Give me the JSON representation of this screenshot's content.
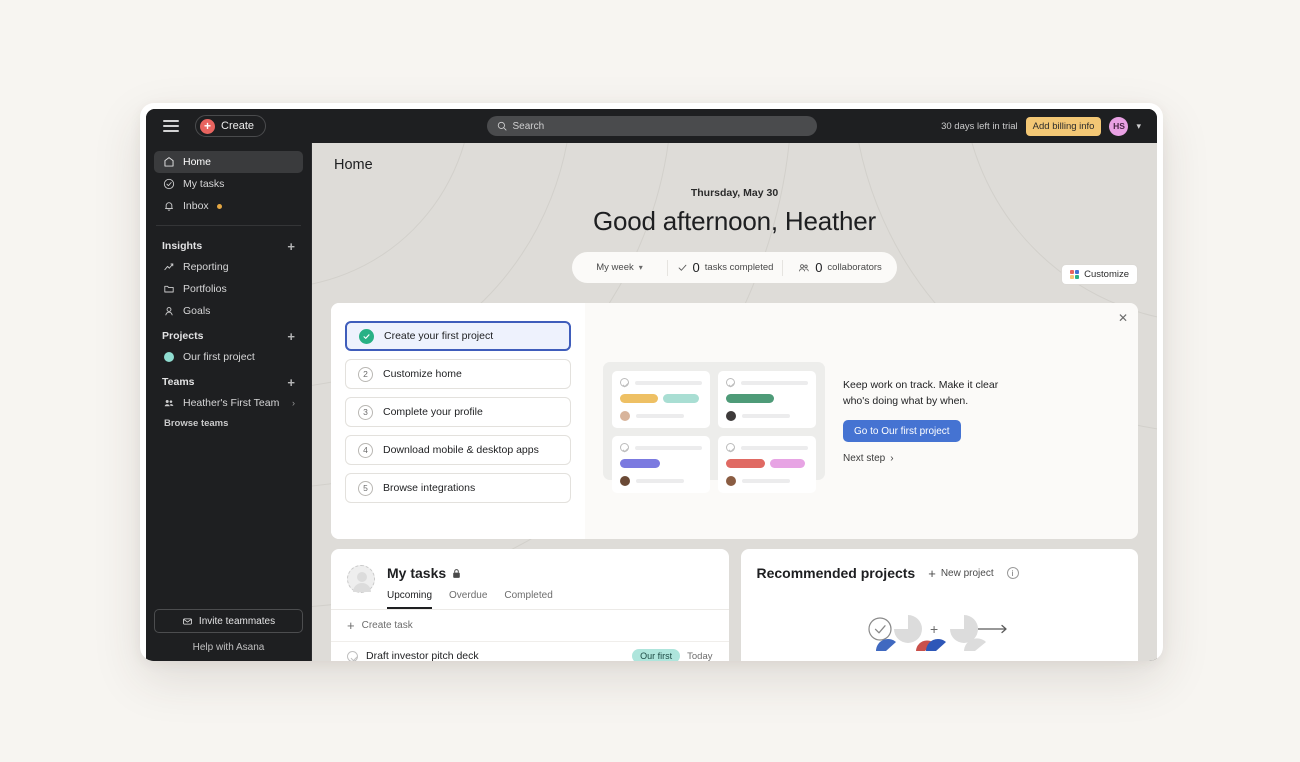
{
  "topbar": {
    "menu_icon": "hamburger-icon",
    "create_label": "Create",
    "search_placeholder": "Search",
    "trial_text": "30 days left in trial",
    "billing_label": "Add billing info",
    "avatar_initials": "HS"
  },
  "sidebar": {
    "primary": [
      {
        "label": "Home",
        "icon": "home-icon",
        "active": true
      },
      {
        "label": "My tasks",
        "icon": "check-circle-icon",
        "active": false
      },
      {
        "label": "Inbox",
        "icon": "bell-icon",
        "active": false,
        "badge": true
      }
    ],
    "insights": {
      "title": "Insights",
      "items": [
        {
          "label": "Reporting",
          "icon": "chart-line-icon"
        },
        {
          "label": "Portfolios",
          "icon": "folder-icon"
        },
        {
          "label": "Goals",
          "icon": "goal-icon"
        }
      ]
    },
    "projects": {
      "title": "Projects",
      "items": [
        {
          "label": "Our first project",
          "color": "#8fdcd0"
        }
      ]
    },
    "teams": {
      "title": "Teams",
      "items": [
        {
          "label": "Heather's First Team",
          "icon": "people-icon"
        }
      ],
      "browse_label": "Browse teams"
    },
    "invite_label": "Invite teammates",
    "help_label": "Help with Asana"
  },
  "main": {
    "page_title": "Home",
    "date": "Thursday, May 30",
    "greeting": "Good afternoon, Heather",
    "stats": {
      "range_label": "My week",
      "tasks_value": "0",
      "tasks_label": "tasks completed",
      "collaborators_value": "0",
      "collaborators_label": "collaborators"
    },
    "customize_label": "Customize"
  },
  "onboarding": {
    "steps": [
      {
        "num": "1",
        "label": "Create your first project",
        "done": true
      },
      {
        "num": "2",
        "label": "Customize home",
        "done": false
      },
      {
        "num": "3",
        "label": "Complete your profile",
        "done": false
      },
      {
        "num": "4",
        "label": "Download mobile & desktop apps",
        "done": false
      },
      {
        "num": "5",
        "label": "Browse integrations",
        "done": false
      }
    ],
    "copy": "Keep work on track. Make it clear who's doing what by when.",
    "cta_label": "Go to Our first project",
    "next_label": "Next step",
    "close_icon": "close-icon",
    "illustration_tags": [
      [
        "#eec064",
        "#a9ded3"
      ],
      [
        "#4e9b78"
      ],
      [
        "#7b7ae0"
      ],
      [
        "#e06a63",
        "#e7a4e4"
      ]
    ]
  },
  "my_tasks": {
    "title": "My tasks",
    "lock_icon": "lock-icon",
    "tabs": [
      {
        "label": "Upcoming",
        "active": true
      },
      {
        "label": "Overdue",
        "active": false
      },
      {
        "label": "Completed",
        "active": false
      }
    ],
    "create_task_label": "Create task",
    "rows": [
      {
        "name": "Draft investor pitch deck",
        "project": "Our first",
        "date": "Today"
      }
    ]
  },
  "recommended": {
    "title": "Recommended projects",
    "new_project_label": "New project",
    "info_icon": "info-icon"
  },
  "colors": {
    "accent_blue": "#4573d2",
    "green": "#28b185",
    "create_red": "#e8645f",
    "billing_yellow": "#f3c775",
    "sidebar_bg": "#1e1f21",
    "main_bg": "#dedcd8"
  }
}
